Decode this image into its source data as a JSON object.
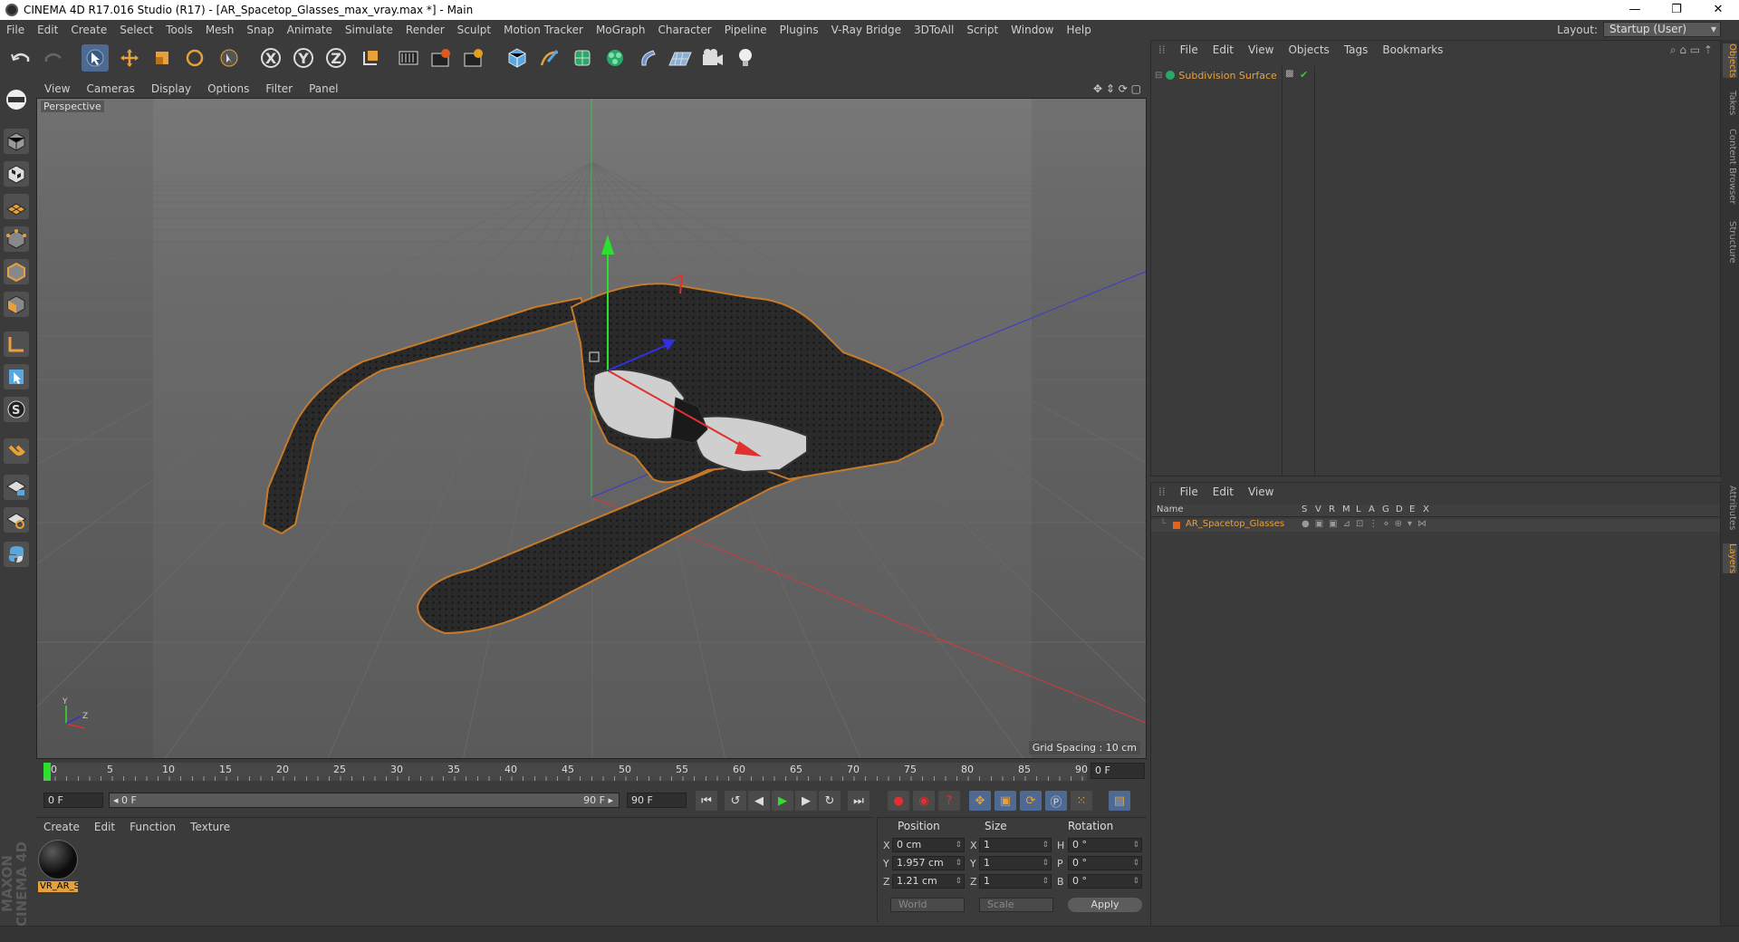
{
  "window": {
    "title": "CINEMA 4D R17.016 Studio (R17) - [AR_Spacetop_Glasses_max_vray.max *] - Main",
    "minimize": "—",
    "maximize": "❐",
    "close": "✕"
  },
  "menu": [
    "File",
    "Edit",
    "Create",
    "Select",
    "Tools",
    "Mesh",
    "Snap",
    "Animate",
    "Simulate",
    "Render",
    "Sculpt",
    "Motion Tracker",
    "MoGraph",
    "Character",
    "Pipeline",
    "Plugins",
    "V-Ray Bridge",
    "3DToAll",
    "Script",
    "Window",
    "Help"
  ],
  "layout": {
    "label": "Layout:",
    "value": "Startup (User)"
  },
  "toolbar": {
    "x_label": "X",
    "y_label": "Y",
    "z_label": "Z"
  },
  "viewport": {
    "menu": [
      "View",
      "Cameras",
      "Display",
      "Options",
      "Filter",
      "Panel"
    ],
    "label": "Perspective",
    "grid_spacing": "Grid Spacing : 10 cm",
    "axis_y": "Y",
    "axis_z": "Z"
  },
  "timeline": {
    "ticks": [
      "0",
      "5",
      "10",
      "15",
      "20",
      "25",
      "30",
      "35",
      "40",
      "45",
      "50",
      "55",
      "60",
      "65",
      "70",
      "75",
      "80",
      "85",
      "90"
    ],
    "current_frame": "0 F"
  },
  "transport": {
    "start_field": "0 F",
    "range_start": "◂ 0 F",
    "range_end": "90 F ▸",
    "end_field": "90 F"
  },
  "material_panel": {
    "menu": [
      "Create",
      "Edit",
      "Function",
      "Texture"
    ],
    "material_name": "VR_AR_S"
  },
  "coordinates": {
    "headers": {
      "position": "Position",
      "size": "Size",
      "rotation": "Rotation"
    },
    "rows": [
      {
        "axis": "X",
        "pos": "0 cm",
        "size_axis": "X",
        "size": "1",
        "rot_axis": "H",
        "rot": "0 °"
      },
      {
        "axis": "Y",
        "pos": "1.957 cm",
        "size_axis": "Y",
        "size": "1",
        "rot_axis": "P",
        "rot": "0 °"
      },
      {
        "axis": "Z",
        "pos": "1.21 cm",
        "size_axis": "Z",
        "size": "1",
        "rot_axis": "B",
        "rot": "0 °"
      }
    ],
    "coord_system": "World",
    "mode": "Scale",
    "apply": "Apply"
  },
  "object_manager": {
    "menu": [
      "File",
      "Edit",
      "View",
      "Objects",
      "Tags",
      "Bookmarks"
    ],
    "object": "Subdivision Surface"
  },
  "layer_manager": {
    "menu": [
      "File",
      "Edit",
      "View"
    ],
    "columns": [
      "Name",
      "S",
      "V",
      "R",
      "M",
      "L",
      "A",
      "G",
      "D",
      "E",
      "X"
    ],
    "layer": "AR_Spacetop_Glasses",
    "layer_color": "#e0641e"
  },
  "right_tabs": [
    "Objects",
    "Takes",
    "Content Browser",
    "Structure",
    "Attributes",
    "Layers"
  ],
  "logo": "MAXON CINEMA 4D",
  "colors": {
    "accent": "#e8a13a",
    "selection": "#4f6a92"
  }
}
